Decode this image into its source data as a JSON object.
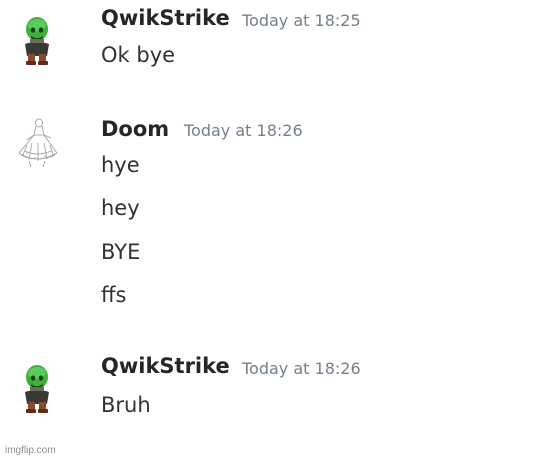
{
  "messages": [
    {
      "author": "QwikStrike",
      "timestamp": "Today at 18:25",
      "avatar_icon": "green-masked-figure-avatar",
      "lines": [
        "Ok bye"
      ]
    },
    {
      "author": "Doom",
      "timestamp": "Today at 18:26",
      "avatar_icon": "sketch-figure-avatar",
      "lines": [
        "hye",
        "hey",
        "BYE",
        "ffs"
      ]
    },
    {
      "author": "QwikStrike",
      "timestamp": "Today at 18:26",
      "avatar_icon": "green-masked-figure-avatar",
      "lines": [
        "Bruh"
      ]
    }
  ],
  "watermark": "imgflip.com",
  "colors": {
    "username": "#23272a",
    "timestamp": "#747f8d",
    "message_text": "#2e3338",
    "background": "#ffffff"
  }
}
